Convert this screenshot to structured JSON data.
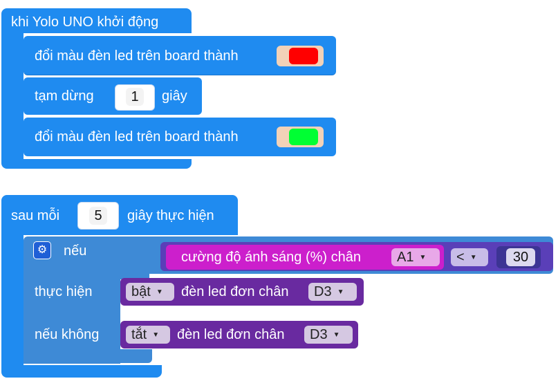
{
  "block1": {
    "header": "khi Yolo UNO khởi động",
    "led_set_1": {
      "label": "đổi màu đèn led trên board thành",
      "color": "#ff0000"
    },
    "pause": {
      "label_before": "tạm dừng",
      "value": "1",
      "label_after": "giây"
    },
    "led_set_2": {
      "label": "đổi màu đèn led trên board thành",
      "color": "#00ff33"
    }
  },
  "block2": {
    "header_before": "sau mỗi",
    "interval": "5",
    "header_after": "giây thực hiện",
    "if_block": {
      "gear_icon": "gear-icon",
      "if_label": "nếu",
      "condition": {
        "sensor_label": "cường độ ánh sáng (%) chân",
        "pin": "A1",
        "operator": "<",
        "threshold": "30"
      },
      "then_label": "thực hiện",
      "then_action": {
        "state": "bật",
        "label": "đèn led đơn chân",
        "pin": "D3"
      },
      "else_label": "nếu không",
      "else_action": {
        "state": "tắt",
        "label": "đèn led đơn chân",
        "pin": "D3"
      }
    }
  },
  "colors": {
    "event_blue": "#1f8bf0",
    "logic_steel": "#3e8ad6",
    "io_purple": "#692aa0",
    "sensor_magenta": "#cc1fcc",
    "math_indigo": "#5a3fb8"
  }
}
